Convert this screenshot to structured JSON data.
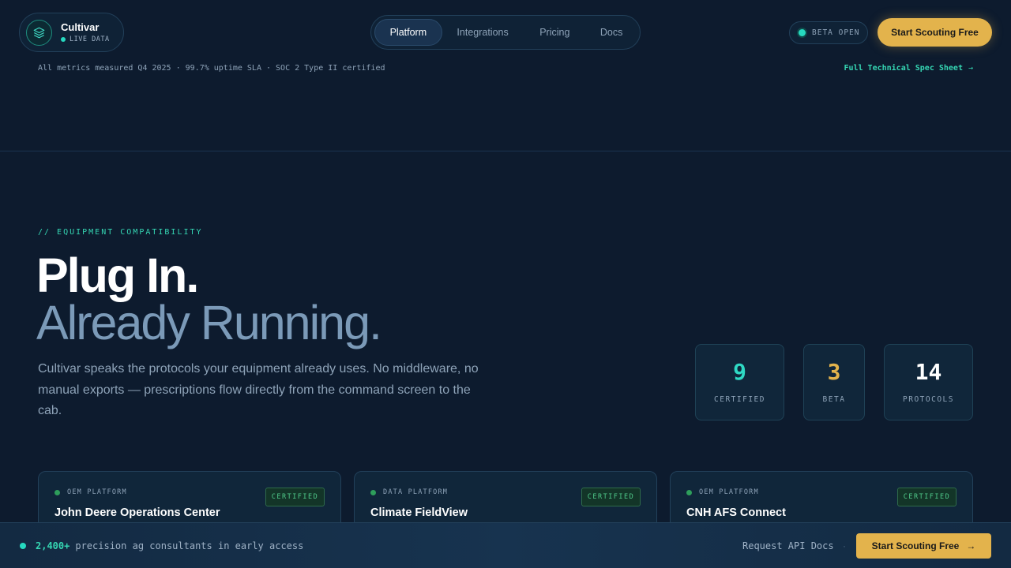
{
  "brand": {
    "name": "Cultivar",
    "status": "LIVE DATA",
    "icon": "layers-icon"
  },
  "nav": {
    "items": [
      "Platform",
      "Integrations",
      "Pricing",
      "Docs"
    ],
    "active": "Platform"
  },
  "header": {
    "beta_label": "BETA OPEN",
    "cta_label": "Start Scouting Free"
  },
  "metrics_line": "All metrics measured Q4 2025 · 99.7% uptime SLA · SOC 2 Type II certified",
  "spec_link": "Full Technical Spec Sheet",
  "hero": {
    "eyebrow": "// EQUIPMENT COMPATIBILITY",
    "title_line1": "Plug In.",
    "title_line2": "Already Running.",
    "lead": "Cultivar speaks the protocols your equipment already uses. No middleware, no manual exports — prescriptions flow directly from the command screen to the cab."
  },
  "stats": [
    {
      "value": "9",
      "label": "CERTIFIED",
      "color": "#2fd9c4"
    },
    {
      "value": "3",
      "label": "BETA",
      "color": "#e3b34c"
    },
    {
      "value": "14",
      "label": "PROTOCOLS",
      "color": "#ffffff"
    }
  ],
  "cards": [
    {
      "type": "OEM PLATFORM",
      "title": "John Deere Operations Center",
      "badge": "CERTIFIED"
    },
    {
      "type": "DATA PLATFORM",
      "title": "Climate FieldView",
      "badge": "CERTIFIED"
    },
    {
      "type": "OEM PLATFORM",
      "title": "CNH AFS Connect",
      "badge": "CERTIFIED"
    }
  ],
  "bottom_bar": {
    "count": "2,400+",
    "text": "precision ag consultants in early access",
    "link": "Request API Docs",
    "separator": "·",
    "cta_label": "Start Scouting Free"
  },
  "colors": {
    "accent": "#35d6b3",
    "cta": "#e3b34c",
    "background": "#0d1b2e"
  }
}
